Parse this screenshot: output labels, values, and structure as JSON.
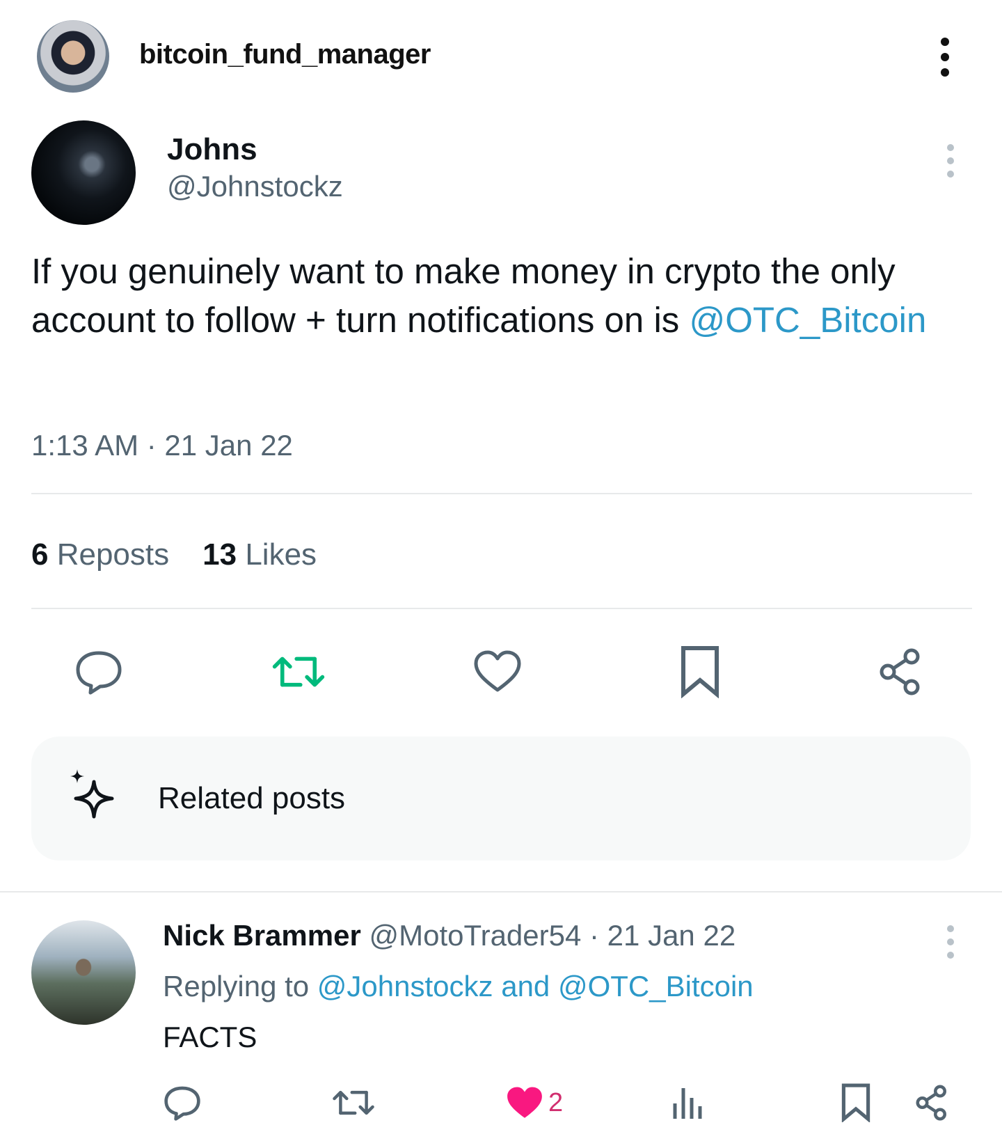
{
  "header": {
    "username": "bitcoin_fund_manager",
    "avatar_icon": "profile-photo",
    "more_icon": "vertical-ellipsis-icon"
  },
  "tweet": {
    "author_name": "Johns",
    "author_handle": "@Johnstockz",
    "text_part1": "If you genuinely want to make money in crypto the only account to follow + turn notifications on is ",
    "mention": "@OTC_Bitcoin",
    "time": "1:13 AM · 21 Jan 22",
    "reposts_count": "6",
    "reposts_label": "Reposts",
    "likes_count": "13",
    "likes_label": "Likes",
    "actions": [
      "reply-icon",
      "repost-icon",
      "like-icon",
      "bookmark-icon",
      "share-icon"
    ],
    "repost_color": "#00ba7c"
  },
  "related": {
    "label": "Related posts",
    "icon": "sparkle-icon"
  },
  "reply": {
    "author_name": "Nick Brammer",
    "author_handle": "@MotoTrader54",
    "date": "· 21 Jan 22",
    "replying_prefix": "Replying to ",
    "replying_targets": "@Johnstockz and @OTC_Bitcoin",
    "text": "FACTS",
    "like_count": "2",
    "like_color": "#f91880",
    "actions": [
      "reply-icon",
      "repost-icon",
      "like-icon",
      "views-icon",
      "bookmark-icon",
      "share-icon"
    ]
  }
}
